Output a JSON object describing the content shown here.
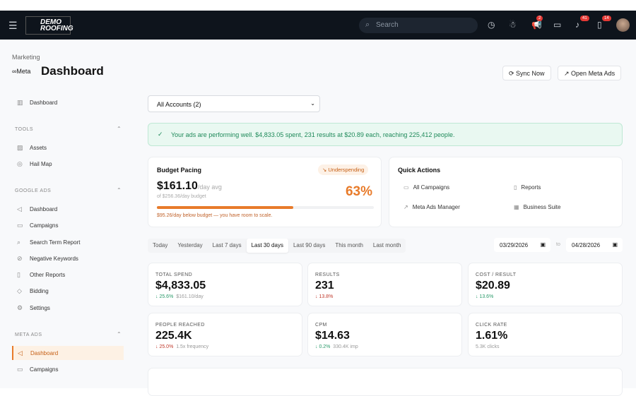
{
  "nav": {
    "logo_text": "DEMO ROOFING",
    "search_placeholder": "Search",
    "badges": {
      "megaphone": "2",
      "bell": "41",
      "clipboard": "14"
    }
  },
  "header": {
    "breadcrumb": "Marketing",
    "brand": "Meta",
    "title": "Dashboard",
    "sync": "Sync Now",
    "open_meta": "Open Meta Ads"
  },
  "sidebar": {
    "top": "Dashboard",
    "tools_head": "TOOLS",
    "tools": [
      "Assets",
      "Hail Map"
    ],
    "google_head": "GOOGLE ADS",
    "google": [
      "Dashboard",
      "Campaigns",
      "Search Term Report",
      "Negative Keywords",
      "Other Reports",
      "Bidding",
      "Settings"
    ],
    "meta_head": "META ADS",
    "meta": [
      "Dashboard",
      "Campaigns"
    ]
  },
  "account_select": "All Accounts (2)",
  "alert": "Your ads are performing well. $4,833.05 spent, 231 results at $20.89 each, reaching 225,412 people.",
  "budget": {
    "title": "Budget Pacing",
    "status": "Underspending",
    "amount": "$161.10",
    "unit": "/day avg",
    "of": "of $256.36/day budget",
    "percent": "63%",
    "progress": 63,
    "note": "$95.26/day below budget — you have room to scale.",
    "accent": "#e87b2a"
  },
  "quick": {
    "title": "Quick Actions",
    "items": [
      "All Campaigns",
      "Reports",
      "Meta Ads Manager",
      "Business Suite"
    ]
  },
  "ranges": [
    "Today",
    "Yesterday",
    "Last 7 days",
    "Last 30 days",
    "Last 90 days",
    "This month",
    "Last month"
  ],
  "active_range": "Last 30 days",
  "date_from": "03/29/2026",
  "date_to_label": "to",
  "date_to": "04/28/2026",
  "kpis": [
    {
      "label": "TOTAL SPEND",
      "value": "$4,833.05",
      "change": "↓ 25.6%",
      "dir": "up",
      "extra": "$161.10/day"
    },
    {
      "label": "RESULTS",
      "value": "231",
      "change": "↓ 13.8%",
      "dir": "down",
      "extra": ""
    },
    {
      "label": "COST / RESULT",
      "value": "$20.89",
      "change": "↓ 13.6%",
      "dir": "up",
      "extra": ""
    },
    {
      "label": "PEOPLE REACHED",
      "value": "225.4K",
      "change": "↓ 25.0%",
      "dir": "down",
      "extra": "1.5x frequency"
    },
    {
      "label": "CPM",
      "value": "$14.63",
      "change": "↓ 0.2%",
      "dir": "up",
      "extra": "330.4K imp"
    },
    {
      "label": "CLICK RATE",
      "value": "1.61%",
      "change": "",
      "dir": "",
      "extra": "5.3K clicks"
    }
  ]
}
